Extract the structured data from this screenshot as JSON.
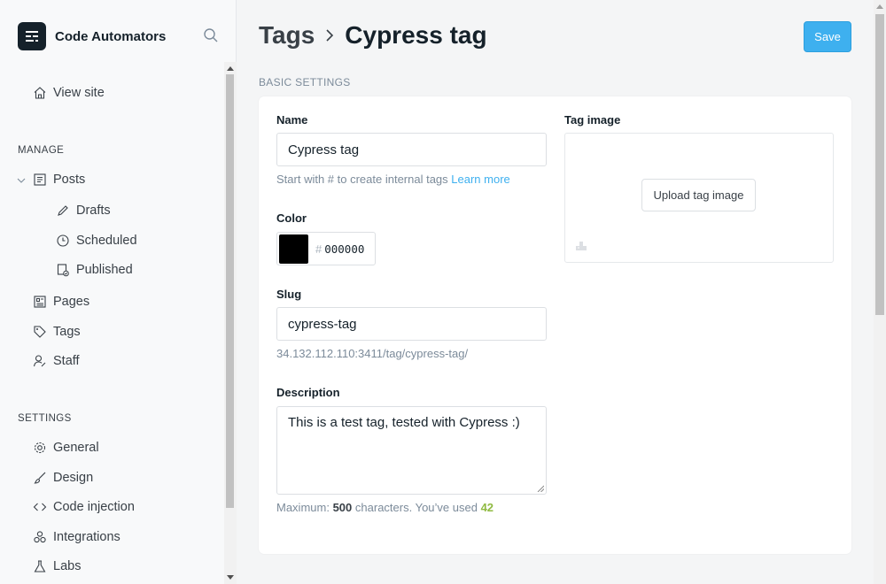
{
  "brand": {
    "name": "Code Automators"
  },
  "sidebar": {
    "view_site": "View site",
    "manage_heading": "MANAGE",
    "posts": "Posts",
    "drafts": "Drafts",
    "scheduled": "Scheduled",
    "published": "Published",
    "pages": "Pages",
    "tags": "Tags",
    "staff": "Staff",
    "settings_heading": "SETTINGS",
    "general": "General",
    "design": "Design",
    "code_injection": "Code injection",
    "integrations": "Integrations",
    "labs": "Labs"
  },
  "header": {
    "crumb_parent": "Tags",
    "crumb_current": "Cypress tag",
    "save_label": "Save"
  },
  "form": {
    "section_title": "BASIC SETTINGS",
    "name_label": "Name",
    "name_value": "Cypress tag",
    "name_help": "Start with # to create internal tags",
    "learn_more": "Learn more",
    "color_label": "Color",
    "color_hash": "#",
    "color_value": "000000",
    "slug_label": "Slug",
    "slug_value": "cypress-tag",
    "slug_url": "34.132.112.110:3411/tag/cypress-tag/",
    "description_label": "Description",
    "description_value": "This is a test tag, tested with Cypress :)",
    "desc_help_prefix": "Maximum:",
    "desc_max": "500",
    "desc_help_mid": "characters. You’ve used",
    "desc_used": "42",
    "tag_image_label": "Tag image",
    "upload_label": "Upload tag image"
  },
  "colors": {
    "accent": "#3eb0ef",
    "swatch": "#000000",
    "counter_ok": "#8fba41"
  }
}
